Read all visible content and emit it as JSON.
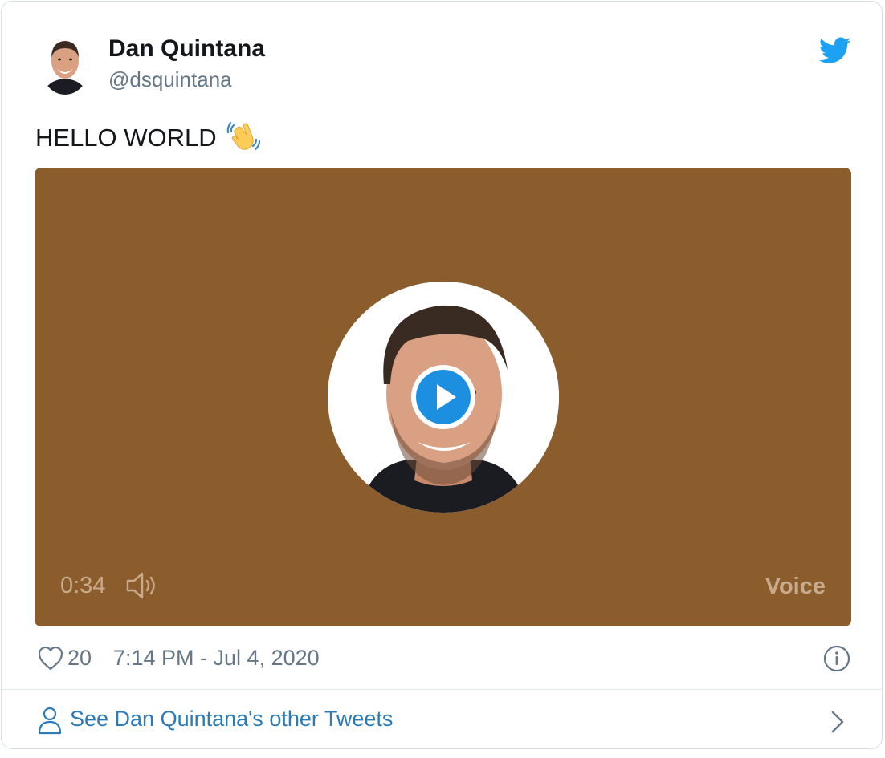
{
  "author": {
    "name": "Dan Quintana",
    "handle": "@dsquintana"
  },
  "tweet": {
    "text": "HELLO WORLD",
    "emoji": "waving-hand"
  },
  "media": {
    "duration": "0:34",
    "badge": "Voice",
    "background_color": "#8b5d2c"
  },
  "footer": {
    "likes": "20",
    "timestamp": "7:14 PM - Jul 4, 2020",
    "see_more": "See Dan Quintana's other Tweets"
  },
  "colors": {
    "brand_blue": "#1da1f2",
    "link_blue": "#2b7bb9",
    "muted_gray": "#657786"
  },
  "icons": [
    "twitter-bird-icon",
    "play-icon",
    "volume-icon",
    "heart-icon",
    "info-icon",
    "person-icon",
    "chevron-right-icon"
  ]
}
